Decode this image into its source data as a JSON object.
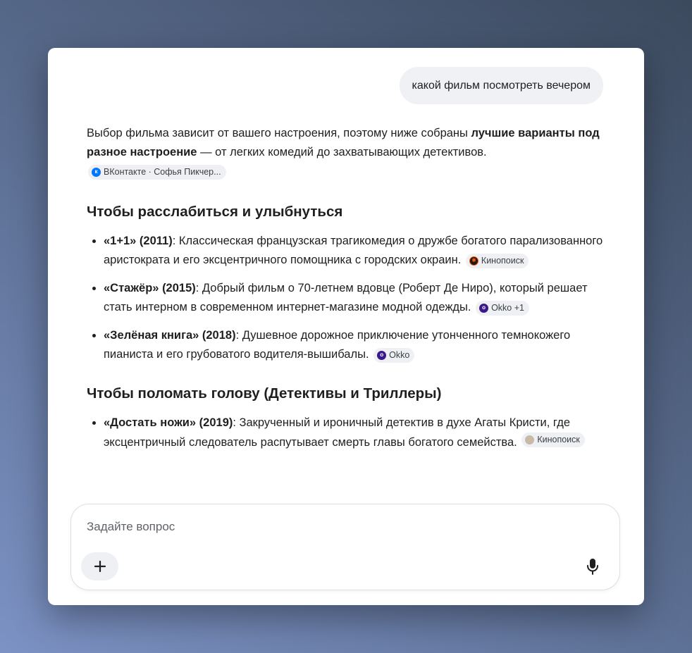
{
  "user_message": "какой фильм посмотреть вечером",
  "intro": {
    "text_before": "Выбор фильма зависит от вашего настроения, поэтому ниже собраны ",
    "bold": "лучшие варианты под разное настроение",
    "text_after": " — от легких комедий до захватывающих детективов.",
    "source": "ВКонтакте · Софья Пикчер..."
  },
  "sections": [
    {
      "heading": "Чтобы расслабиться и улыбнуться",
      "items": [
        {
          "title": "«1+1» (2011)",
          "text": ": Классическая французская трагикомедия о дружбе богатого парализованного аристократа и его эксцентричного помощника с городских окраин.",
          "source": "Кинопоиск"
        },
        {
          "title": "«Стажёр» (2015)",
          "text": ": Добрый фильм о 70-летнем вдовце (Роберт Де Ниро), который решает стать интерном в современном интернет-магазине модной одежды.",
          "source": "Okko +1"
        },
        {
          "title": "«Зелёная книга» (2018)",
          "text": ": Душевное дорожное приключение утонченного темнокожего пианиста и его грубоватого водителя-вышибалы.",
          "source": "Okko"
        }
      ]
    },
    {
      "heading": "Чтобы поломать голову (Детективы и Триллеры)",
      "items": [
        {
          "title": "«Достать ножи» (2019)",
          "text": ": Закрученный и ироничный детектив в духе Агаты Кристи, где эксцентричный следователь распутывает смерть главы богатого семейства.",
          "source": "Кинопоиск"
        }
      ]
    }
  ],
  "composer": {
    "placeholder": "Задайте вопрос"
  },
  "icons": {
    "add": "plus-icon",
    "mic": "microphone-icon",
    "vk": "vk-logo-icon",
    "kinopoisk": "kinopoisk-logo-icon",
    "okko": "okko-logo-icon"
  },
  "colors": {
    "user_bubble": "#f0f1f4",
    "chip": "#eef0f3",
    "vk": "#0077ff",
    "kinopoisk": "#ff5500",
    "okko": "#3a1a8a"
  }
}
